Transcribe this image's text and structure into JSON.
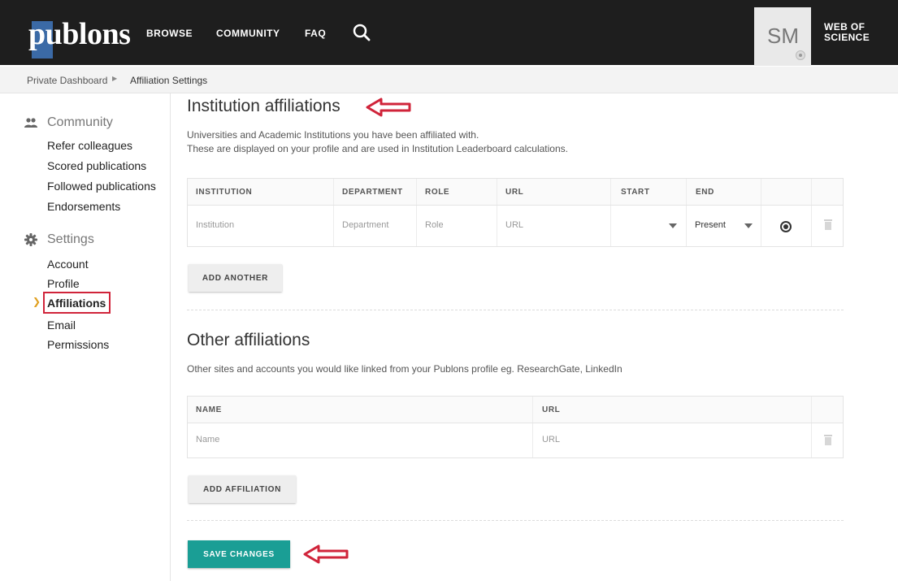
{
  "header": {
    "logo": "publons",
    "nav": [
      "BROWSE",
      "COMMUNITY",
      "FAQ"
    ],
    "avatar_initials": "SM",
    "wos_line1": "WEB OF",
    "wos_line2": "SCIENCE"
  },
  "breadcrumb": {
    "items": [
      "Private Dashboard",
      "Affiliation Settings"
    ]
  },
  "sidebar": {
    "community_heading": "Community",
    "community_links": [
      "Refer colleagues",
      "Scored publications",
      "Followed publications",
      "Endorsements"
    ],
    "settings_heading": "Settings",
    "settings_links": [
      "Account",
      "Profile",
      "Affiliations",
      "Email",
      "Permissions"
    ],
    "active_link": "Affiliations"
  },
  "institution": {
    "title": "Institution affiliations",
    "desc_line1": "Universities and Academic Institutions you have been affiliated with.",
    "desc_line2": "These are displayed on your profile and are used in Institution Leaderboard calculations.",
    "columns": [
      "INSTITUTION",
      "DEPARTMENT",
      "ROLE",
      "URL",
      "START",
      "END"
    ],
    "row": {
      "institution_placeholder": "Institution",
      "department_placeholder": "Department",
      "role_placeholder": "Role",
      "url_placeholder": "URL",
      "start_value": "",
      "end_value": "Present",
      "primary_selected": true
    },
    "add_button": "ADD ANOTHER"
  },
  "other": {
    "title": "Other affiliations",
    "desc": "Other sites and accounts you would like linked from your Publons profile eg. ResearchGate, LinkedIn",
    "columns": [
      "NAME",
      "URL"
    ],
    "row": {
      "name_placeholder": "Name",
      "url_placeholder": "URL"
    },
    "add_button": "ADD AFFILIATION"
  },
  "save_button": "SAVE CHANGES",
  "colors": {
    "topbar": "#1e1e1e",
    "logo_block": "#3b6aa6",
    "save": "#1a9e95",
    "annotation_red": "#d0243a"
  },
  "icons": [
    "search-icon",
    "gear-icon",
    "community-icon",
    "settings-icon",
    "chevron-right-icon",
    "caret-down-icon",
    "radio-icon",
    "trash-icon",
    "red-arrow-icon"
  ]
}
